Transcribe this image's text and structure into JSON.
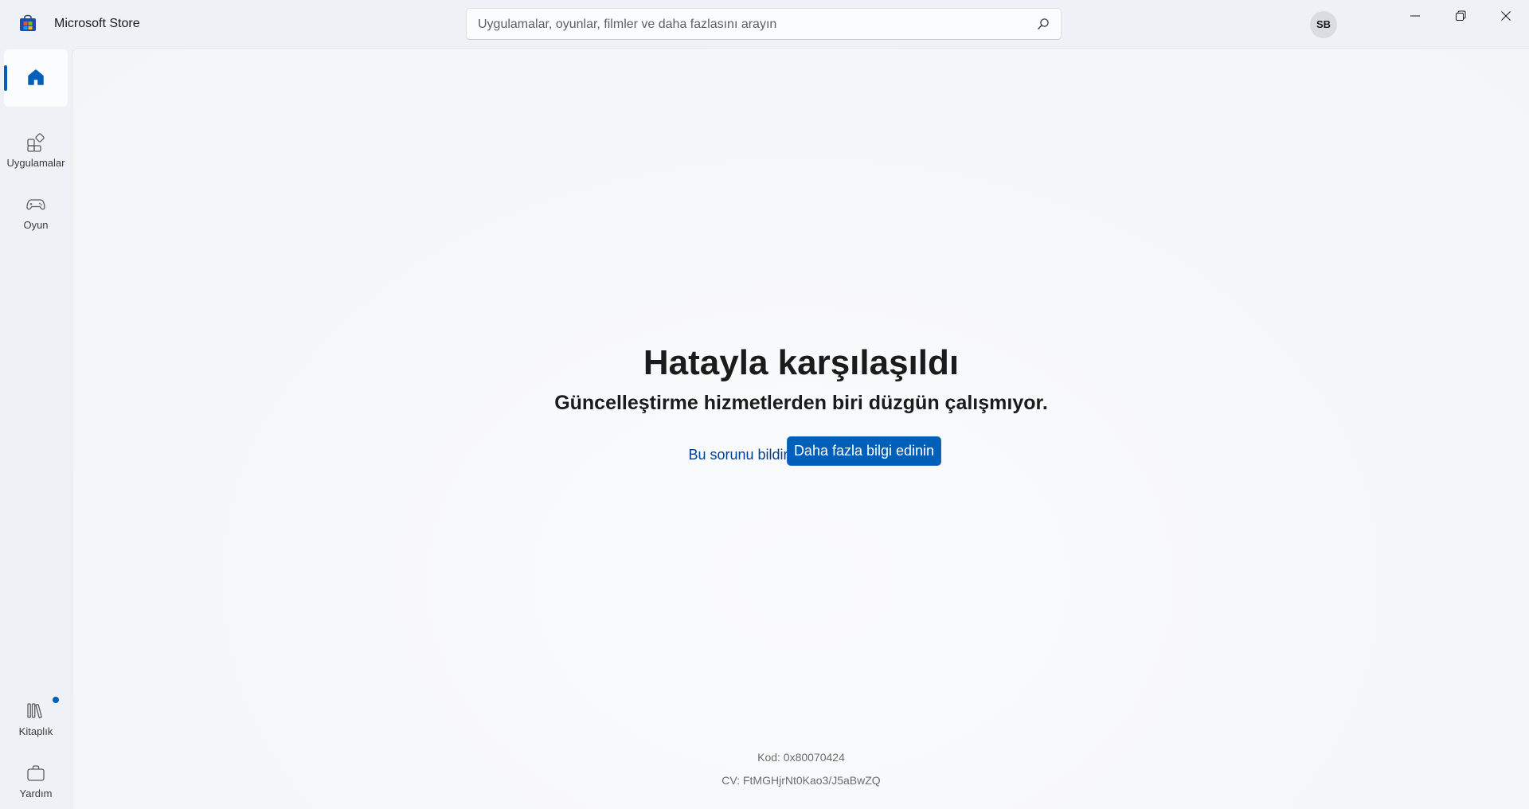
{
  "titlebar": {
    "app_title": "Microsoft Store",
    "search_placeholder": "Uygulamalar, oyunlar, filmler ve daha fazlasını arayın",
    "avatar_initials": "SB"
  },
  "sidebar": {
    "items": [
      {
        "name": "home",
        "label": "",
        "icon": "home-icon",
        "active": true
      },
      {
        "name": "apps",
        "label": "Uygulamalar",
        "icon": "apps-icon"
      },
      {
        "name": "gaming",
        "label": "Oyun",
        "icon": "gamepad-icon"
      },
      {
        "name": "library",
        "label": "Kitaplık",
        "icon": "library-icon",
        "has_badge": true
      },
      {
        "name": "help",
        "label": "Yardım",
        "icon": "briefcase-icon"
      }
    ]
  },
  "error": {
    "title": "Hatayla karşılaşıldı",
    "subtitle": "Güncelleştirme hizmetlerden biri düzgün çalışmıyor.",
    "report_link": "Bu sorunu bildir",
    "learn_more_button": "Daha fazla bilgi edinin",
    "code": "Kod: 0x80070424",
    "cv": "CV: FtMGHjrNt0Kao3/J5aBwZQ"
  },
  "colors": {
    "accent": "#005fb8",
    "background": "#eef2f7",
    "panel": "#f7f8fa"
  }
}
